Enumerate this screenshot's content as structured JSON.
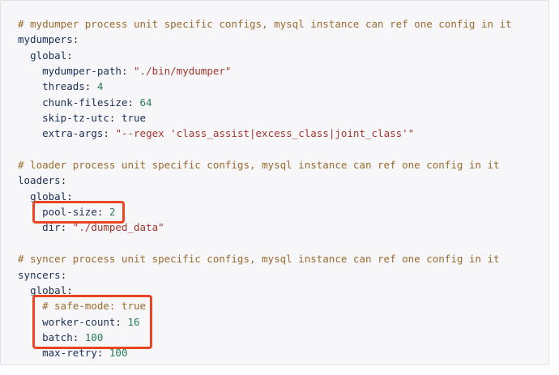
{
  "code": {
    "lines": [
      {
        "indent": "",
        "comment": "# mydumper process unit specific configs, mysql instance can ref one config in it"
      },
      {
        "indent": "",
        "key": "mydumpers",
        "sep": ":"
      },
      {
        "indent": "  ",
        "key": "global",
        "sep": ":"
      },
      {
        "indent": "    ",
        "key": "mydumper-path",
        "sep": ": ",
        "value": "\"./bin/mydumper\"",
        "vtype": "str"
      },
      {
        "indent": "    ",
        "key": "threads",
        "sep": ": ",
        "value": "4",
        "vtype": "num"
      },
      {
        "indent": "    ",
        "key": "chunk-filesize",
        "sep": ": ",
        "value": "64",
        "vtype": "num"
      },
      {
        "indent": "    ",
        "key": "skip-tz-utc",
        "sep": ": ",
        "value": "true",
        "vtype": "bool"
      },
      {
        "indent": "    ",
        "key": "extra-args",
        "sep": ": ",
        "value": "\"--regex 'class_assist|excess_class|joint_class'\"",
        "vtype": "str"
      },
      {
        "indent": "",
        "blank": " "
      },
      {
        "indent": "",
        "comment": "# loader process unit specific configs, mysql instance can ref one config in it"
      },
      {
        "indent": "",
        "key": "loaders",
        "sep": ":"
      },
      {
        "indent": "  ",
        "key": "global",
        "sep": ":"
      },
      {
        "indent": "    ",
        "key": "pool-size",
        "sep": ": ",
        "value": "2",
        "vtype": "num"
      },
      {
        "indent": "    ",
        "key": "dir",
        "sep": ": ",
        "value": "\"./dumped_data\"",
        "vtype": "str"
      },
      {
        "indent": "",
        "blank": " "
      },
      {
        "indent": "",
        "comment": "# syncer process unit specific configs, mysql instance can ref one config in it"
      },
      {
        "indent": "",
        "key": "syncers",
        "sep": ":"
      },
      {
        "indent": "  ",
        "key": "global",
        "sep": ":"
      },
      {
        "indent": "    ",
        "comment": "# safe-mode: true"
      },
      {
        "indent": "    ",
        "key": "worker-count",
        "sep": ": ",
        "value": "16",
        "vtype": "num"
      },
      {
        "indent": "    ",
        "key": "batch",
        "sep": ": ",
        "value": "100",
        "vtype": "num"
      },
      {
        "indent": "    ",
        "key": "max-retry",
        "sep": ": ",
        "value": "100",
        "vtype": "num"
      }
    ]
  },
  "colors": {
    "highlight_border": "#ea4624",
    "comment": "#9a6a2e",
    "string": "#a3362d",
    "number": "#2a7d55",
    "key": "#1b2f56",
    "background": "#f7f7f9"
  }
}
